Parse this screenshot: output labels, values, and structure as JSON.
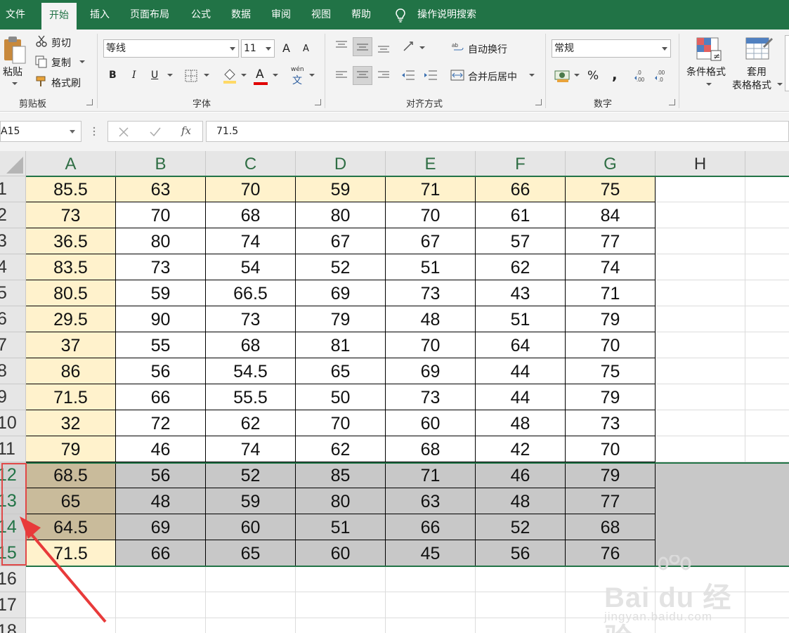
{
  "tabs": {
    "file": "文件",
    "home": "开始",
    "insert": "插入",
    "page_layout": "页面布局",
    "formulas": "公式",
    "data": "数据",
    "review": "审阅",
    "view": "视图",
    "help": "帮助",
    "tell_me": "操作说明搜索"
  },
  "ribbon": {
    "clipboard": {
      "paste": "粘贴",
      "cut": "剪切",
      "copy": "复制",
      "format_painter": "格式刷",
      "label": "剪贴板"
    },
    "font": {
      "family": "等线",
      "size": "11",
      "bold": "B",
      "italic": "I",
      "underline": "U",
      "font_color_glyph": "A",
      "phonetic_top": "wén",
      "phonetic_bottom": "文",
      "grow": "A",
      "shrink": "A",
      "label": "字体"
    },
    "alignment": {
      "wrap_text": "自动换行",
      "merge_center": "合并后居中",
      "label": "对齐方式"
    },
    "number": {
      "format": "常规",
      "percent": "%",
      "comma": ",",
      "label": "数字"
    },
    "styles": {
      "conditional": "条件格式",
      "table_top": "套用",
      "table_bottom": "表格格式"
    }
  },
  "formula_bar": {
    "name_box": "A15",
    "fx": "fx",
    "value": "71.5"
  },
  "sheet": {
    "columns": [
      "A",
      "B",
      "C",
      "D",
      "E",
      "F",
      "G",
      "H"
    ],
    "rows": [
      [
        "85.5",
        "63",
        "70",
        "59",
        "71",
        "66",
        "75"
      ],
      [
        "73",
        "70",
        "68",
        "80",
        "70",
        "61",
        "84"
      ],
      [
        "36.5",
        "80",
        "74",
        "67",
        "67",
        "57",
        "77"
      ],
      [
        "83.5",
        "73",
        "54",
        "52",
        "51",
        "62",
        "74"
      ],
      [
        "80.5",
        "59",
        "66.5",
        "69",
        "73",
        "43",
        "71"
      ],
      [
        "29.5",
        "90",
        "73",
        "79",
        "48",
        "51",
        "79"
      ],
      [
        "37",
        "55",
        "68",
        "81",
        "70",
        "64",
        "70"
      ],
      [
        "86",
        "56",
        "54.5",
        "65",
        "69",
        "44",
        "75"
      ],
      [
        "71.5",
        "66",
        "55.5",
        "50",
        "73",
        "44",
        "79"
      ],
      [
        "32",
        "72",
        "62",
        "70",
        "60",
        "48",
        "73"
      ],
      [
        "79",
        "46",
        "74",
        "62",
        "68",
        "42",
        "70"
      ],
      [
        "68.5",
        "56",
        "52",
        "85",
        "71",
        "46",
        "79"
      ],
      [
        "65",
        "48",
        "59",
        "80",
        "63",
        "48",
        "77"
      ],
      [
        "64.5",
        "69",
        "60",
        "51",
        "66",
        "52",
        "68"
      ],
      [
        "71.5",
        "66",
        "65",
        "60",
        "45",
        "56",
        "76"
      ]
    ],
    "row_numbers": [
      "1",
      "2",
      "3",
      "4",
      "5",
      "6",
      "7",
      "8",
      "9",
      "10",
      "11",
      "12",
      "13",
      "14",
      "15",
      "16",
      "17",
      "18"
    ],
    "selected_rows": [
      "12",
      "13",
      "14",
      "15"
    ],
    "highlight_color": "#fff2cc",
    "selection_color": "#c8c8c8",
    "accent_color": "#217346"
  },
  "annotation": {
    "box_color": "#e04848",
    "arrow_color": "#e83a3a"
  },
  "watermark": {
    "brand": "Bai du 经验",
    "url": "jingyan.baidu.com"
  }
}
